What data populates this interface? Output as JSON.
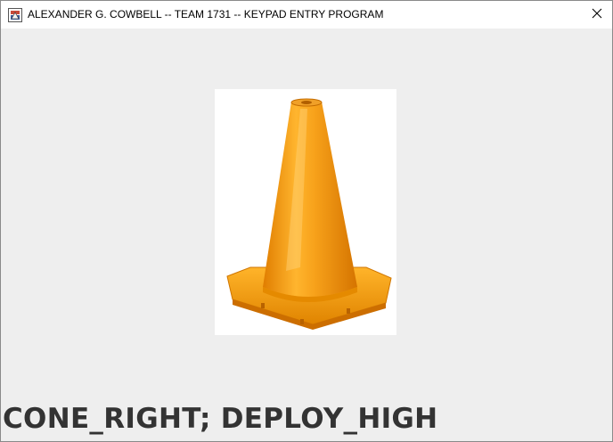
{
  "window": {
    "title": "ALEXANDER G. COWBELL -- TEAM 1731 -- KEYPAD ENTRY PROGRAM",
    "app_icon": "java-app-icon",
    "close_icon": "close-icon"
  },
  "content": {
    "image": {
      "subject": "traffic-cone",
      "color": "#f5a200"
    },
    "status_text": "CONE_RIGHT; DEPLOY_HIGH"
  },
  "colors": {
    "window_background": "#eeeeee",
    "titlebar_background": "#ffffff",
    "status_text": "#333333"
  }
}
